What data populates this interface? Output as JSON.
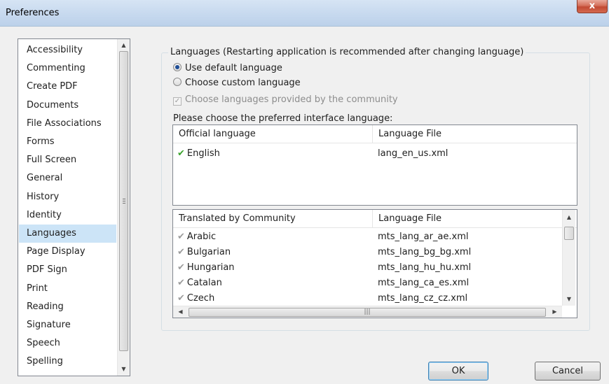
{
  "window": {
    "title": "Preferences",
    "close_label": "x"
  },
  "categories": [
    "Accessibility",
    "Commenting",
    "Create PDF",
    "Documents",
    "File Associations",
    "Forms",
    "Full Screen",
    "General",
    "History",
    "Identity",
    "Languages",
    "Page Display",
    "PDF Sign",
    "Print",
    "Reading",
    "Signature",
    "Speech",
    "Spelling"
  ],
  "selected_category": "Languages",
  "languages": {
    "group_title": "Languages (Restarting application is recommended after changing language)",
    "option_default": "Use default language",
    "option_custom": "Choose custom language",
    "option_community": "Choose languages provided by the community",
    "prompt": "Please choose the preferred interface language:",
    "official_table": {
      "headers": [
        "Official language",
        "Language File"
      ],
      "rows": [
        {
          "language": "English",
          "file": "lang_en_us.xml"
        }
      ]
    },
    "community_table": {
      "headers": [
        "Translated by Community",
        "Language File"
      ],
      "rows": [
        {
          "language": "Arabic",
          "file": "mts_lang_ar_ae.xml"
        },
        {
          "language": "Bulgarian",
          "file": "mts_lang_bg_bg.xml"
        },
        {
          "language": "Hungarian",
          "file": "mts_lang_hu_hu.xml"
        },
        {
          "language": "Catalan",
          "file": "mts_lang_ca_es.xml"
        },
        {
          "language": "Czech",
          "file": "mts_lang_cz_cz.xml"
        }
      ]
    }
  },
  "buttons": {
    "ok": "OK",
    "cancel": "Cancel"
  }
}
